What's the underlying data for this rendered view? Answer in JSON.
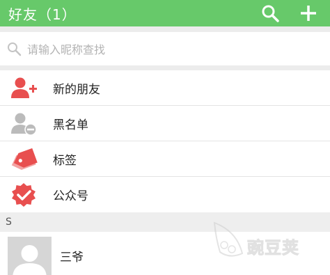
{
  "header": {
    "title": "好友（1）",
    "background": "#67c96a",
    "icons": [
      "search-icon",
      "plus-icon"
    ]
  },
  "search": {
    "placeholder": "请输入昵称查找"
  },
  "menu": [
    {
      "label": "新的朋友",
      "icon": "add-user-icon",
      "color": "#e84f4f"
    },
    {
      "label": "黑名单",
      "icon": "blocked-user-icon",
      "color": "#bbbbbb"
    },
    {
      "label": "标签",
      "icon": "tag-icon",
      "color": "#e84f4f"
    },
    {
      "label": "公众号",
      "icon": "verified-badge-icon",
      "color": "#e84f4f"
    }
  ],
  "section": {
    "letter": "S"
  },
  "contacts": [
    {
      "name": "三爷",
      "icon": "avatar-placeholder-icon"
    }
  ],
  "watermark": {
    "text": "豌豆荚",
    "icon": "pea-pod-logo"
  }
}
